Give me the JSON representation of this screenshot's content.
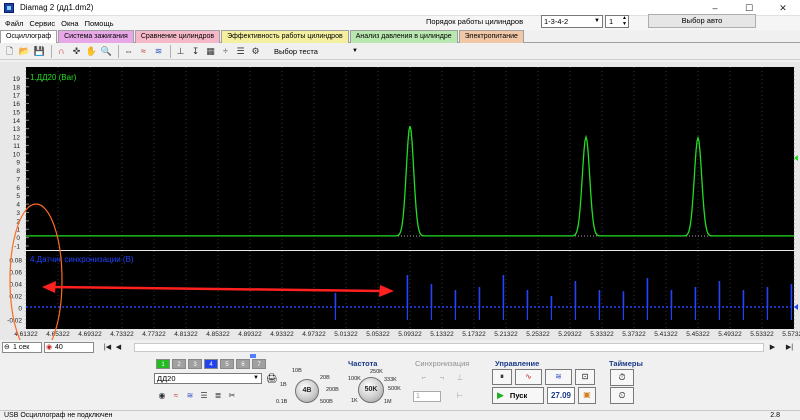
{
  "window": {
    "title": "Diamag 2 (дд1.dm2)",
    "controls": [
      "–",
      "☐",
      "✕"
    ]
  },
  "menu": [
    "Файл",
    "Сервис",
    "Окна",
    "Помощь"
  ],
  "cylinder_order": {
    "label": "Порядок работы цилиндров",
    "value": "1-3-4-2",
    "spin_value": "1",
    "auto_button": "Выбор авто"
  },
  "tabs": [
    {
      "label": "Осциллограф",
      "color": "#ffffff",
      "active": true
    },
    {
      "label": "Система зажигания",
      "color": "#e8a8e8"
    },
    {
      "label": "Сравнение цилиндров",
      "color": "#f4b8c8"
    },
    {
      "label": "Эффективность работы цилиндров",
      "color": "#f4f0a0"
    },
    {
      "label": "Анализ давления в цилиндре",
      "color": "#b8e8b0"
    },
    {
      "label": "Электропитание",
      "color": "#f0c8a8"
    }
  ],
  "toolbar": {
    "test_select": "Выбор теста"
  },
  "scope": {
    "ch1_label": "1.ДД20 (Bar)",
    "ch1_color": "#22dd22",
    "ch1_ticks": [
      "19",
      "18",
      "17",
      "16",
      "15",
      "14",
      "13",
      "12",
      "11",
      "10",
      "9",
      "8",
      "7",
      "6",
      "5",
      "4",
      "3",
      "2",
      "1",
      "0",
      "-1"
    ],
    "ch2_label": "4.Датчик синхронизации (В)",
    "ch2_color": "#2222ff",
    "ch2_ticks": [
      "0.08",
      "0.06",
      "0.04",
      "0.02",
      "0",
      "-0.02"
    ],
    "time_ticks": [
      "4.61322",
      "4.65322",
      "4.69322",
      "4.73322",
      "4.77322",
      "4.81322",
      "4.85322",
      "4.89322",
      "4.93322",
      "4.97322",
      "5.01322",
      "5.05322",
      "5.09322",
      "5.13322",
      "5.17322",
      "5.21322",
      "5.25322",
      "5.29322",
      "5.33322",
      "5.37322",
      "5.41322",
      "5.45322",
      "5.49322",
      "5.53322",
      "5.57322"
    ]
  },
  "chart_data": [
    {
      "type": "line",
      "title": "1.ДД20 (Bar)",
      "xlim": [
        4.61322,
        5.57322
      ],
      "ylim": [
        -1,
        20
      ],
      "series": [
        {
          "name": "1.ДД20 (Bar)",
          "x": [
            4.61322,
            5.09,
            5.09322,
            5.096,
            5.31,
            5.31322,
            5.316,
            5.45,
            5.45322,
            5.456,
            5.57322
          ],
          "y": [
            0.2,
            0.2,
            13.3,
            0.2,
            0.2,
            12.0,
            0.2,
            0.2,
            11.9,
            0.2,
            0.2
          ]
        }
      ]
    },
    {
      "type": "line",
      "title": "4.Датчик синхронизации (В)",
      "xlim": [
        4.61322,
        5.57322
      ],
      "ylim": [
        -0.03,
        0.09
      ],
      "series": [
        {
          "name": "4.Датчик синхронизации (В)",
          "x": [
            5.0,
            5.09,
            5.12,
            5.15,
            5.18,
            5.21,
            5.24,
            5.27,
            5.3,
            5.33,
            5.36,
            5.39,
            5.42,
            5.45,
            5.48,
            5.51,
            5.54,
            5.57
          ],
          "y": [
            0.025,
            0.055,
            0.04,
            0.03,
            0.035,
            0.055,
            0.03,
            0.02,
            0.045,
            0.03,
            0.028,
            0.05,
            0.03,
            0.035,
            0.045,
            0.03,
            0.035,
            0.04
          ]
        }
      ]
    }
  ],
  "nav": {
    "time_scale": "1 сек",
    "count": "40",
    "buttons": [
      "|◀",
      "◀",
      "▶",
      "▶|"
    ]
  },
  "controls": {
    "channels": [
      {
        "label": "1",
        "color": "#22bb22"
      },
      {
        "label": "2",
        "color": "#a0a0a0"
      },
      {
        "label": "3",
        "color": "#a0a0a0"
      },
      {
        "label": "4",
        "color": "#2244ee"
      },
      {
        "label": "5",
        "color": "#a0a0a0"
      },
      {
        "label": "6",
        "color": "#a0a0a0"
      },
      {
        "label": "7",
        "color": "#a0a0a0"
      }
    ],
    "sensor": "ДД20",
    "range_knob": "4B",
    "range_labels": [
      "10B",
      "20B",
      "1B",
      "200B",
      "0.1B",
      "500B"
    ],
    "freq_title": "Частота",
    "freq_knob": "50K",
    "freq_labels": [
      "250K",
      "100K",
      "333K",
      "1K",
      "500K",
      "1M"
    ],
    "sync_title": "Синхронизация",
    "sync_select": "1",
    "manage_title": "Управление",
    "run_label": "Пуск",
    "run_value": "27.09",
    "timers_title": "Таймеры"
  },
  "status": {
    "text": "USB Осциллограф не подключен",
    "version": "2.8"
  }
}
